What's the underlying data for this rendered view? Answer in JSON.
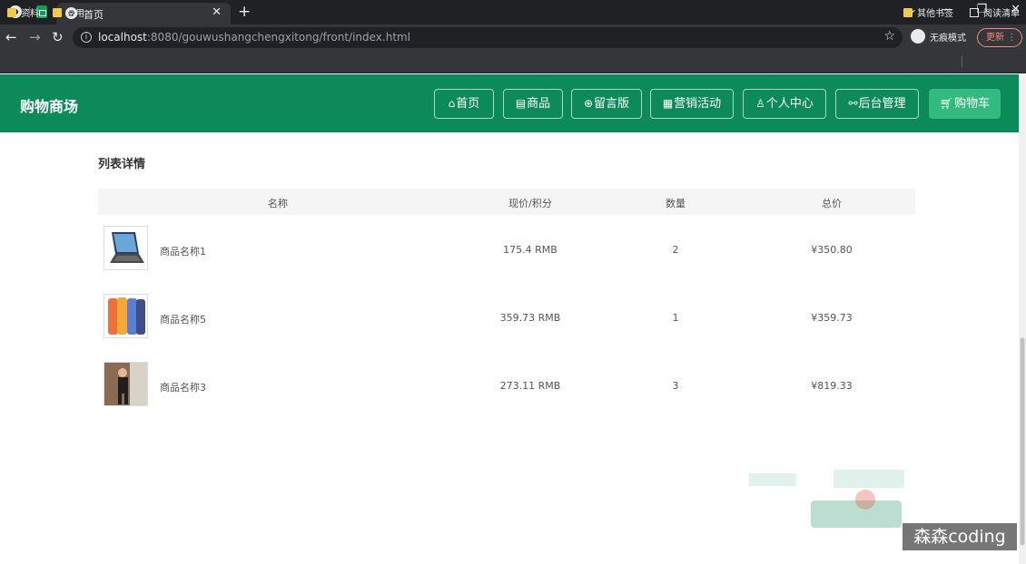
{
  "browser": {
    "tab_title": "首页",
    "url_host": "localhost",
    "url_rest": ":8080/gouwushangchengxitong/front/index.html",
    "incognito_label": "无痕模式",
    "update_label": "更新",
    "bookmarks": [
      {
        "label": "资料"
      },
      {
        "label": "常用"
      },
      {
        "label": "其他书签"
      },
      {
        "label": "阅读清单"
      }
    ]
  },
  "site": {
    "brand": "购物商场",
    "nav": [
      {
        "label": "首页",
        "icon": "home-icon"
      },
      {
        "label": "商品",
        "icon": "calendar-icon"
      },
      {
        "label": "留言版",
        "icon": "globe-icon"
      },
      {
        "label": "营销活动",
        "icon": "grid-icon"
      },
      {
        "label": "个人中心",
        "icon": "user-icon"
      },
      {
        "label": "后台管理",
        "icon": "link-icon"
      },
      {
        "label": "购物车",
        "icon": "cart-icon"
      }
    ]
  },
  "cart": {
    "section_title": "列表详情",
    "columns": [
      "名称",
      "现价/积分",
      "数量",
      "总价"
    ],
    "rows": [
      {
        "name": "商品名称1",
        "price": "175.4 RMB",
        "qty": "2",
        "total": "¥350.80",
        "image": "laptop-image"
      },
      {
        "name": "商品名称5",
        "price": "359.73 RMB",
        "qty": "1",
        "total": "¥359.73",
        "image": "phones-image"
      },
      {
        "name": "商品名称3",
        "price": "273.11 RMB",
        "qty": "3",
        "total": "¥819.33",
        "image": "person-photo"
      }
    ]
  },
  "watermark": "森森coding",
  "colors": {
    "header_green": "#0c8a5a",
    "active_green": "#33bb7f",
    "chrome_dark": "#202124",
    "chrome_mid": "#35363a"
  }
}
